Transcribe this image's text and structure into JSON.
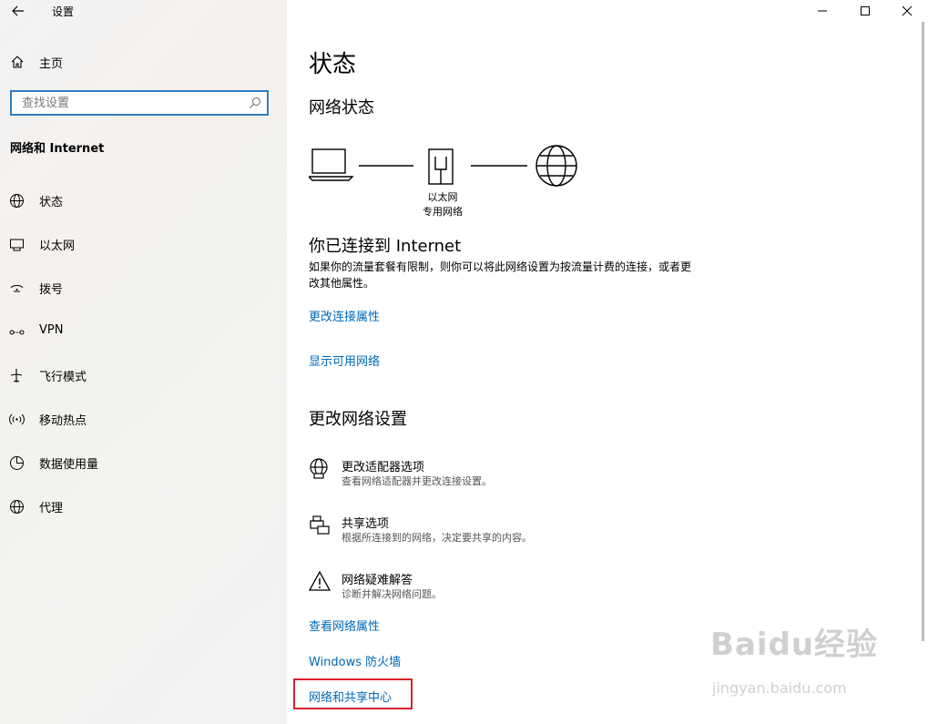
{
  "window": {
    "title": "设置",
    "controls": {
      "minimize": "minimize-icon",
      "maximize": "maximize-icon",
      "close": "close-icon"
    }
  },
  "sidebar": {
    "home_label": "主页",
    "search_placeholder": "查找设置",
    "section_title": "网络和 Internet",
    "items": [
      {
        "label": "状态",
        "icon": "globe-icon"
      },
      {
        "label": "以太网",
        "icon": "ethernet-icon"
      },
      {
        "label": "拨号",
        "icon": "dialup-icon"
      },
      {
        "label": "VPN",
        "icon": "vpn-icon"
      },
      {
        "label": "飞行模式",
        "icon": "airplane-icon"
      },
      {
        "label": "移动热点",
        "icon": "hotspot-icon"
      },
      {
        "label": "数据使用量",
        "icon": "data-usage-icon"
      },
      {
        "label": "代理",
        "icon": "proxy-globe-icon"
      }
    ]
  },
  "main": {
    "title": "状态",
    "network_status_heading": "网络状态",
    "diagram": {
      "adapter_name": "以太网",
      "network_type": "专用网络"
    },
    "connected_heading": "你已连接到 Internet",
    "connected_desc": "如果你的流量套餐有限制，则你可以将此网络设置为按流量计费的连接，或者更改其他属性。",
    "link_change_props": "更改连接属性",
    "link_show_networks": "显示可用网络",
    "change_settings_heading": "更改网络设置",
    "settings": [
      {
        "title": "更改适配器选项",
        "desc": "查看网络适配器并更改连接设置。",
        "icon": "adapter-globe-icon"
      },
      {
        "title": "共享选项",
        "desc": "根据所连接到的网络，决定要共享的内容。",
        "icon": "sharing-printer-icon"
      },
      {
        "title": "网络疑难解答",
        "desc": "诊断并解决网络问题。",
        "icon": "warning-icon"
      }
    ],
    "link_view_props": "查看网络属性",
    "link_firewall": "Windows 防火墙",
    "link_sharing_center": "网络和共享中心"
  },
  "watermark": {
    "brand": "Baidu经验",
    "url": "jingyan.baidu.com"
  },
  "colors": {
    "link": "#0067b8",
    "accent": "#2f7ec0",
    "highlight": "#d9232c"
  }
}
